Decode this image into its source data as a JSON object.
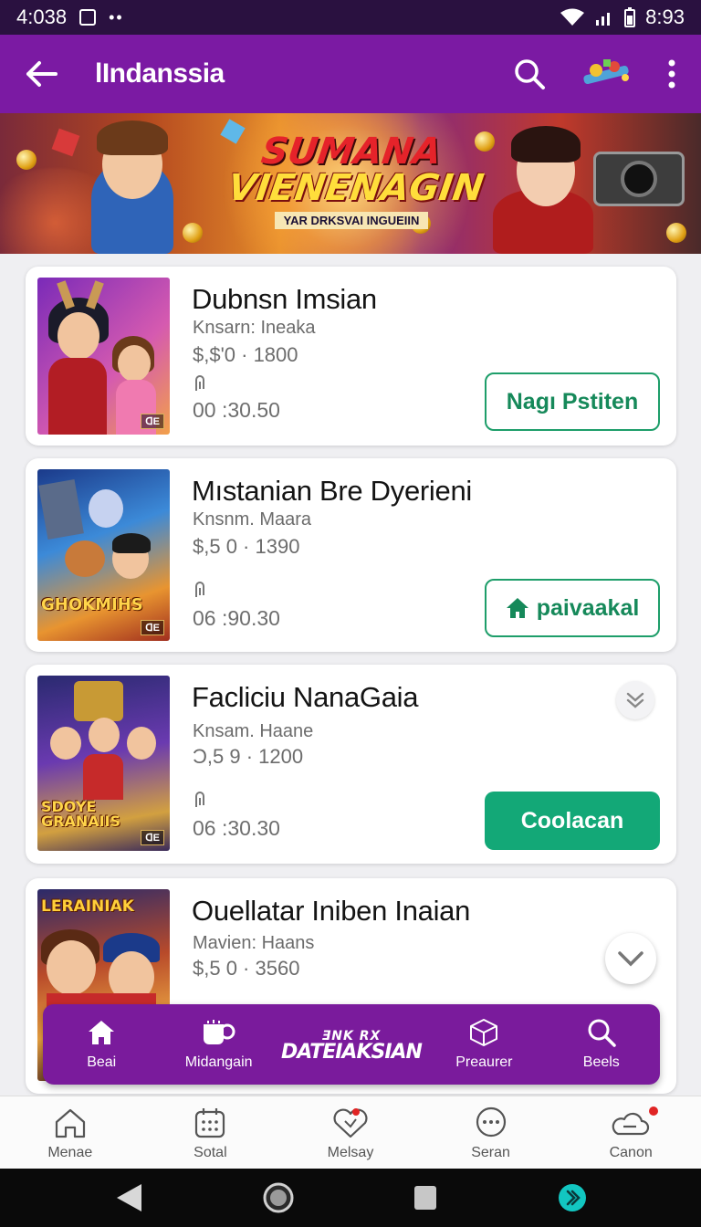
{
  "status_bar": {
    "time": "4:038",
    "clock_right": "8:93"
  },
  "app_bar": {
    "title": "lIndanssia"
  },
  "banner": {
    "headline_1": "SUMANA",
    "headline_2": "VIENENAGIN",
    "subtitle": "YAR DRKSVAI INGUEIIN"
  },
  "items": [
    {
      "title": "Dubnsn Imsian",
      "subtitle": "Knsarn: Ineaka",
      "price": "$,$'0 · 1800",
      "duration": "00 :30.50",
      "button": "Nagı Pstiten",
      "button_style": "outline",
      "thumb_tag": "ᗡE",
      "thumb_logo": ""
    },
    {
      "title": "Mıstanian Bre Dyerieni",
      "subtitle": "Knsnm. Maara",
      "price": "$,5 0 · 1390",
      "duration": "06 :90.30",
      "button": "paivaakal",
      "button_style": "outline",
      "button_icon": "home-icon",
      "thumb_tag": "ᗡE",
      "thumb_logo": "GHOKMIHS"
    },
    {
      "title": "Facliciu NanaGaia",
      "subtitle": "Knsam. Haane",
      "price": "Ͻ,5 9 · 1200",
      "duration": "06 :30.30",
      "button": "Coolacan",
      "button_style": "solid",
      "thumb_tag": "ᗡE",
      "thumb_logo": "SDOYE GRANAIIS"
    },
    {
      "title": "Ouellatar Iniben Inaian",
      "subtitle": "Mavien: Haans",
      "price": "$,5 0 · 3560",
      "thumb_logo": "LERAINIAK"
    }
  ],
  "float_bar": {
    "items": [
      {
        "label": "Beai",
        "icon": "home-icon"
      },
      {
        "label": "Midangain",
        "icon": "cup-icon"
      },
      {
        "logo_line1": "ƎNK RX",
        "logo_line2": "DATEIAKSIAN"
      },
      {
        "label": "Preaurer",
        "icon": "cube-icon"
      },
      {
        "label": "Beels",
        "icon": "search-icon"
      }
    ]
  },
  "bottom_nav": [
    {
      "label": "Menae",
      "icon": "home-outline-icon"
    },
    {
      "label": "Sotal",
      "icon": "calendar-icon"
    },
    {
      "label": "Melsay",
      "icon": "heart-icon"
    },
    {
      "label": "Seran",
      "icon": "chat-icon"
    },
    {
      "label": "Canon",
      "icon": "cloud-icon"
    }
  ],
  "colors": {
    "purple": "#7b1aa3",
    "green": "#13a877",
    "status": "#2a1140"
  }
}
